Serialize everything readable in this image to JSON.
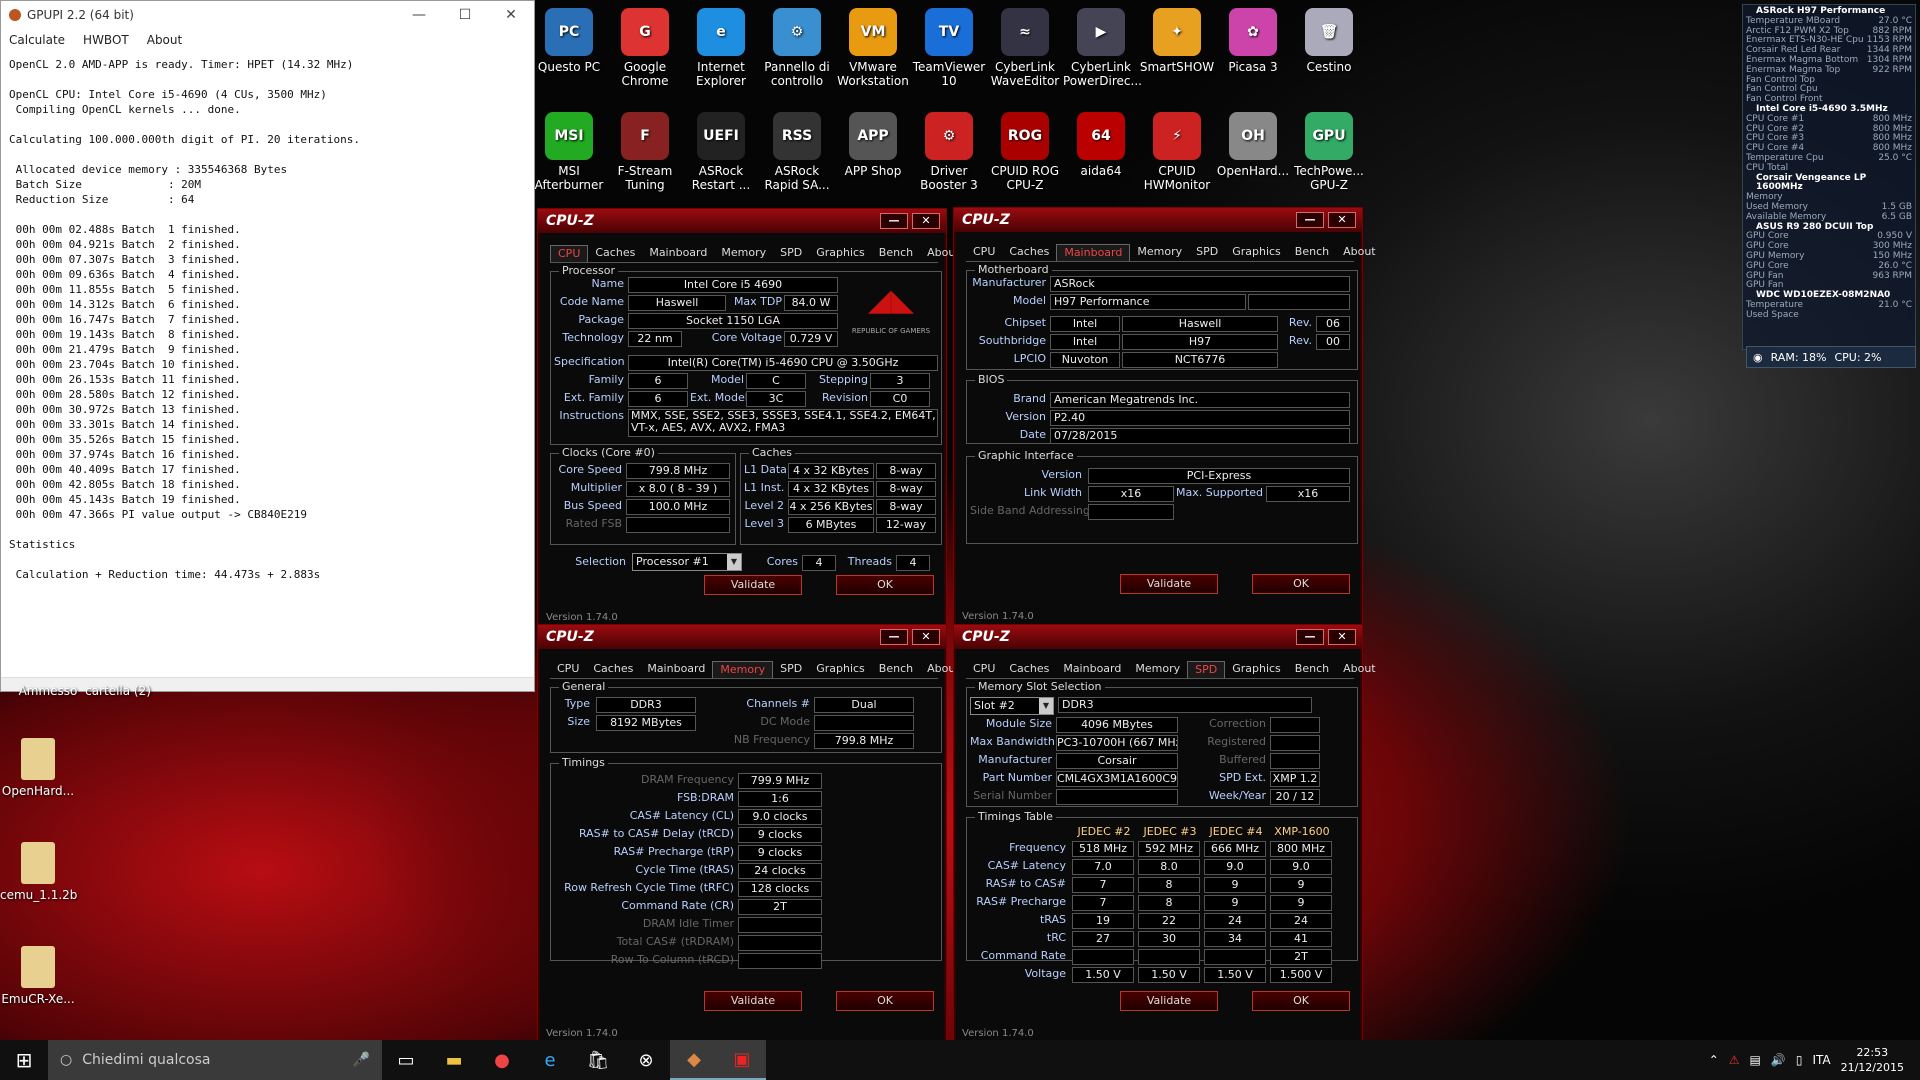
{
  "gpupi": {
    "title": "GPUPI 2.2 (64 bit)",
    "menu": [
      "Calculate",
      "HWBOT",
      "About"
    ],
    "log": "OpenCL 2.0 AMD-APP is ready. Timer: HPET (14.32 MHz)\n\nOpenCL CPU: Intel Core i5-4690 (4 CUs, 3500 MHz)\n Compiling OpenCL kernels ... done.\n\nCalculating 100.000.000th digit of PI. 20 iterations.\n\n Allocated device memory : 335546368 Bytes\n Batch Size             : 20M\n Reduction Size         : 64\n\n 00h 00m 02.488s Batch  1 finished.\n 00h 00m 04.921s Batch  2 finished.\n 00h 00m 07.307s Batch  3 finished.\n 00h 00m 09.636s Batch  4 finished.\n 00h 00m 11.855s Batch  5 finished.\n 00h 00m 14.312s Batch  6 finished.\n 00h 00m 16.747s Batch  7 finished.\n 00h 00m 19.143s Batch  8 finished.\n 00h 00m 21.479s Batch  9 finished.\n 00h 00m 23.704s Batch 10 finished.\n 00h 00m 26.153s Batch 11 finished.\n 00h 00m 28.580s Batch 12 finished.\n 00h 00m 30.972s Batch 13 finished.\n 00h 00m 33.301s Batch 14 finished.\n 00h 00m 35.526s Batch 15 finished.\n 00h 00m 37.974s Batch 16 finished.\n 00h 00m 40.409s Batch 17 finished.\n 00h 00m 42.805s Batch 18 finished.\n 00h 00m 45.143s Batch 19 finished.\n 00h 00m 47.366s PI value output -> CB840E219\n\nStatistics\n\n Calculation + Reduction time: 44.473s + 2.883s"
  },
  "icons": [
    {
      "label": "Questo PC",
      "color": "#2a6fb5",
      "glyph": "PC"
    },
    {
      "label": "Google Chrome",
      "color": "#d33",
      "glyph": "G"
    },
    {
      "label": "Internet Explorer",
      "color": "#1e8fe0",
      "glyph": "e"
    },
    {
      "label": "Pannello di controllo",
      "color": "#3a8fd0",
      "glyph": "⚙"
    },
    {
      "label": "VMware Workstation",
      "color": "#e89a10",
      "glyph": "VM"
    },
    {
      "label": "TeamViewer 10",
      "color": "#1a6ed8",
      "glyph": "TV"
    },
    {
      "label": "CyberLink WaveEditor",
      "color": "#334",
      "glyph": "≈"
    },
    {
      "label": "CyberLink PowerDirec...",
      "color": "#445",
      "glyph": "▶"
    },
    {
      "label": "SmartSHOW",
      "color": "#e8a020",
      "glyph": "✦"
    },
    {
      "label": "Picasa 3",
      "color": "#c4a",
      "glyph": "✿"
    },
    {
      "label": "Cestino",
      "color": "#aab",
      "glyph": "🗑"
    },
    {
      "label": "MSI Afterburner",
      "color": "#2a2",
      "glyph": "MSI"
    },
    {
      "label": "F-Stream Tuning",
      "color": "#822",
      "glyph": "F"
    },
    {
      "label": "ASRock Restart ...",
      "color": "#222",
      "glyph": "UEFI"
    },
    {
      "label": "ASRock Rapid SA...",
      "color": "#333",
      "glyph": "RSS"
    },
    {
      "label": "APP Shop",
      "color": "#555",
      "glyph": "APP"
    },
    {
      "label": "Driver Booster 3",
      "color": "#c22",
      "glyph": "⚙"
    },
    {
      "label": "CPUID ROG CPU-Z",
      "color": "#a00",
      "glyph": "ROG"
    },
    {
      "label": "aida64",
      "color": "#b00",
      "glyph": "64"
    },
    {
      "label": "CPUID HWMonitor",
      "color": "#c22",
      "glyph": "⚡"
    },
    {
      "label": "OpenHard...",
      "color": "#888",
      "glyph": "OH"
    },
    {
      "label": "TechPowe... GPU-Z",
      "color": "#3a6",
      "glyph": "GPU"
    }
  ],
  "left_icons": [
    {
      "label": "OpenHard...",
      "color": "#e8d090"
    },
    {
      "label": "cemu_1.1.2b",
      "color": "#e8d090"
    },
    {
      "label": "EmuCR-Xe...",
      "color": "#e8d090"
    }
  ],
  "partial_labels": [
    "Ammesso",
    "cartella (2)"
  ],
  "cpuz_common": {
    "title": "CPU-Z",
    "tabs": [
      "CPU",
      "Caches",
      "Mainboard",
      "Memory",
      "SPD",
      "Graphics",
      "Bench",
      "About"
    ],
    "validate": "Validate",
    "ok": "OK",
    "version": "Version 1.74.0"
  },
  "cpu": {
    "group": "Processor",
    "name_l": "Name",
    "name": "Intel Core i5 4690",
    "code_l": "Code Name",
    "code": "Haswell",
    "tdp_l": "Max TDP",
    "tdp": "84.0 W",
    "pkg_l": "Package",
    "pkg": "Socket 1150 LGA",
    "tech_l": "Technology",
    "tech": "22 nm",
    "cv_l": "Core Voltage",
    "cv": "0.729 V",
    "spec_l": "Specification",
    "spec": "Intel(R) Core(TM) i5-4690 CPU @ 3.50GHz",
    "fam_l": "Family",
    "fam": "6",
    "model_l": "Model",
    "model": "C",
    "step_l": "Stepping",
    "step": "3",
    "efam_l": "Ext. Family",
    "efam": "6",
    "emodel_l": "Ext. Model",
    "emodel": "3C",
    "rev_l": "Revision",
    "rev": "C0",
    "inst_l": "Instructions",
    "inst": "MMX, SSE, SSE2, SSE3, SSSE3, SSE4.1, SSE4.2, EM64T, VT-x, AES, AVX, AVX2, FMA3",
    "clocks": "Clocks (Core #0)",
    "caches": "Caches",
    "cs_l": "Core Speed",
    "cs": "799.8 MHz",
    "mult_l": "Multiplier",
    "mult": "x 8.0 ( 8 - 39 )",
    "bus_l": "Bus Speed",
    "bus": "100.0 MHz",
    "fsb_l": "Rated FSB",
    "l1d_l": "L1 Data",
    "l1d": "4 x 32 KBytes",
    "l1d_w": "8-way",
    "l1i_l": "L1 Inst.",
    "l1i": "4 x 32 KBytes",
    "l1i_w": "8-way",
    "l2_l": "Level 2",
    "l2": "4 x 256 KBytes",
    "l2_w": "8-way",
    "l3_l": "Level 3",
    "l3": "6 MBytes",
    "l3_w": "12-way",
    "sel_l": "Selection",
    "sel": "Processor #1",
    "cores_l": "Cores",
    "cores": "4",
    "thr_l": "Threads",
    "thr": "4",
    "rog": "REPUBLIC OF GAMERS"
  },
  "mb": {
    "group": "Motherboard",
    "man_l": "Manufacturer",
    "man": "ASRock",
    "model_l": "Model",
    "model": "H97 Performance",
    "chip_l": "Chipset",
    "chip_a": "Intel",
    "chip_b": "Haswell",
    "chip_rev_l": "Rev.",
    "chip_rev": "06",
    "sb_l": "Southbridge",
    "sb_a": "Intel",
    "sb_b": "H97",
    "sb_rev_l": "Rev.",
    "sb_rev": "00",
    "lpc_l": "LPCIO",
    "lpc_a": "Nuvoton",
    "lpc_b": "NCT6776",
    "bios": "BIOS",
    "brand_l": "Brand",
    "brand": "American Megatrends Inc.",
    "ver_l": "Version",
    "ver": "P2.40",
    "date_l": "Date",
    "date": "07/28/2015",
    "gi": "Graphic Interface",
    "gver_l": "Version",
    "gver": "PCI-Express",
    "lw_l": "Link Width",
    "lw": "x16",
    "ms_l": "Max. Supported",
    "ms": "x16",
    "sba_l": "Side Band Addressing"
  },
  "mem": {
    "general": "General",
    "type_l": "Type",
    "type": "DDR3",
    "ch_l": "Channels #",
    "ch": "Dual",
    "size_l": "Size",
    "size": "8192 MBytes",
    "dc_l": "DC Mode",
    "nb_l": "NB Frequency",
    "nb": "799.8 MHz",
    "timings": "Timings",
    "rows": [
      {
        "l": "DRAM Frequency",
        "v": "799.9 MHz",
        "dim": true
      },
      {
        "l": "FSB:DRAM",
        "v": "1:6",
        "dim": false
      },
      {
        "l": "CAS# Latency (CL)",
        "v": "9.0 clocks",
        "dim": false
      },
      {
        "l": "RAS# to CAS# Delay (tRCD)",
        "v": "9 clocks",
        "dim": false
      },
      {
        "l": "RAS# Precharge (tRP)",
        "v": "9 clocks",
        "dim": false
      },
      {
        "l": "Cycle Time (tRAS)",
        "v": "24 clocks",
        "dim": false
      },
      {
        "l": "Row Refresh Cycle Time (tRFC)",
        "v": "128 clocks",
        "dim": false
      },
      {
        "l": "Command Rate (CR)",
        "v": "2T",
        "dim": false
      },
      {
        "l": "DRAM Idle Timer",
        "v": "",
        "dim": true
      },
      {
        "l": "Total CAS# (tRDRAM)",
        "v": "",
        "dim": true
      },
      {
        "l": "Row To Column (tRCD)",
        "v": "",
        "dim": true
      }
    ]
  },
  "spd": {
    "group": "Memory Slot Selection",
    "slot": "Slot #2",
    "type": "DDR3",
    "msize_l": "Module Size",
    "msize": "4096 MBytes",
    "corr_l": "Correction",
    "bw_l": "Max Bandwidth",
    "bw": "PC3-10700H (667 MHz)",
    "reg_l": "Registered",
    "man_l": "Manufacturer",
    "man": "Corsair",
    "buf_l": "Buffered",
    "pn_l": "Part Number",
    "pn": "CML4GX3M1A1600C9",
    "ext_l": "SPD Ext.",
    "ext": "XMP 1.2",
    "sn_l": "Serial Number",
    "wy_l": "Week/Year",
    "wy": "20 / 12",
    "tt": "Timings Table",
    "cols": [
      "JEDEC #2",
      "JEDEC #3",
      "JEDEC #4",
      "XMP-1600"
    ],
    "rows": [
      {
        "l": "Frequency",
        "v": [
          "518 MHz",
          "592 MHz",
          "666 MHz",
          "800 MHz"
        ]
      },
      {
        "l": "CAS# Latency",
        "v": [
          "7.0",
          "8.0",
          "9.0",
          "9.0"
        ]
      },
      {
        "l": "RAS# to CAS#",
        "v": [
          "7",
          "8",
          "9",
          "9"
        ]
      },
      {
        "l": "RAS# Precharge",
        "v": [
          "7",
          "8",
          "9",
          "9"
        ]
      },
      {
        "l": "tRAS",
        "v": [
          "19",
          "22",
          "24",
          "24"
        ]
      },
      {
        "l": "tRC",
        "v": [
          "27",
          "30",
          "34",
          "41"
        ]
      },
      {
        "l": "Command Rate",
        "v": [
          "",
          "",
          "",
          "2T"
        ]
      },
      {
        "l": "Voltage",
        "v": [
          "1.50 V",
          "1.50 V",
          "1.50 V",
          "1.500 V"
        ]
      }
    ]
  },
  "sensors": [
    {
      "h": "ASRock H97 Performance"
    },
    {
      "l": "Temperature MBoard",
      "v": "27.0 °C"
    },
    {
      "l": "Arctic F12 PWM X2 Top",
      "v": "882 RPM"
    },
    {
      "l": "Enermax ETS-N30-HE Cpu",
      "v": "1153 RPM"
    },
    {
      "l": "Corsair Red Led Rear",
      "v": "1344 RPM"
    },
    {
      "l": "Enermax Magma Bottom",
      "v": "1304 RPM"
    },
    {
      "l": "Enermax Magma Top",
      "v": "922 RPM"
    },
    {
      "l": "Fan Control Top",
      "v": ""
    },
    {
      "l": "Fan Control Cpu",
      "v": ""
    },
    {
      "l": "Fan Control Front",
      "v": ""
    },
    {
      "h": "Intel Core i5-4690 3.5MHz"
    },
    {
      "l": "CPU Core #1",
      "v": "800 MHz"
    },
    {
      "l": "CPU Core #2",
      "v": "800 MHz"
    },
    {
      "l": "CPU Core #3",
      "v": "800 MHz"
    },
    {
      "l": "CPU Core #4",
      "v": "800 MHz"
    },
    {
      "l": "Temperature Cpu",
      "v": "25.0 °C"
    },
    {
      "l": "CPU Total",
      "v": ""
    },
    {
      "h": "Corsair Vengeance LP 1600MHz"
    },
    {
      "l": "Memory",
      "v": ""
    },
    {
      "l": "Used Memory",
      "v": "1.5 GB"
    },
    {
      "l": "Available Memory",
      "v": "6.5 GB"
    },
    {
      "h": "ASUS R9 280 DCUII Top"
    },
    {
      "l": "GPU Core",
      "v": "0.950 V"
    },
    {
      "l": "GPU Core",
      "v": "300 MHz"
    },
    {
      "l": "GPU Memory",
      "v": "150 MHz"
    },
    {
      "l": "GPU Core",
      "v": "26.0 °C"
    },
    {
      "l": "GPU Fan",
      "v": "963 RPM"
    },
    {
      "l": "GPU Fan",
      "v": ""
    },
    {
      "h": "WDC WD10EZEX-08M2NA0"
    },
    {
      "l": "Temperature",
      "v": "21.0 °C"
    },
    {
      "l": "Used Space",
      "v": ""
    }
  ],
  "stats": {
    "ram": "RAM: 18%",
    "cpu": "CPU: 2%"
  },
  "taskbar": {
    "search": "Chiedimi qualcosa",
    "lang": "ITA",
    "time": "22:53",
    "date": "21/12/2015"
  }
}
